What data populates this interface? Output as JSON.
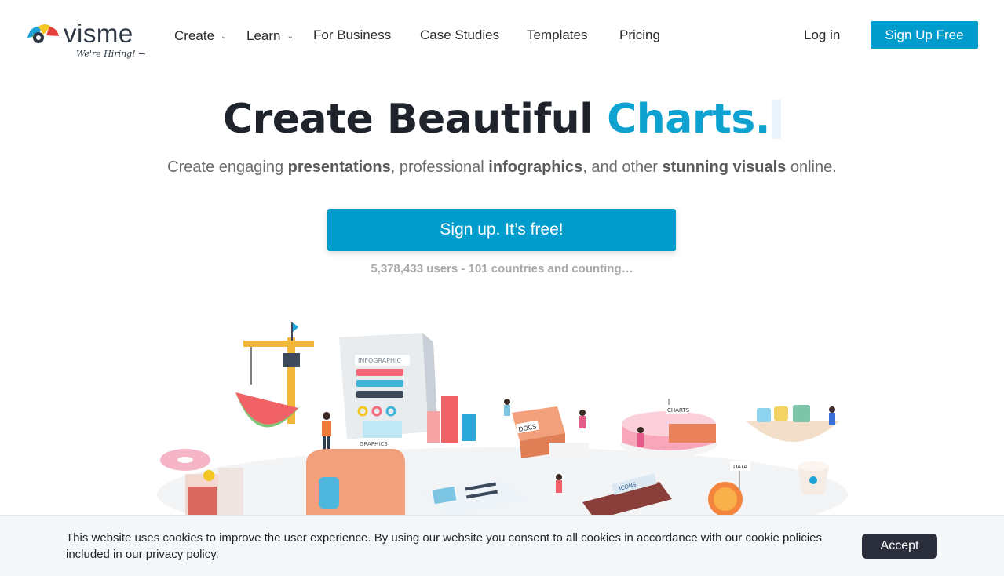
{
  "header": {
    "logo_text": "visme",
    "hiring_link": "We're Hiring! →",
    "nav": [
      {
        "label": "Create",
        "has_dropdown": true
      },
      {
        "label": "Learn",
        "has_dropdown": true
      },
      {
        "label": "For Business",
        "has_dropdown": false
      },
      {
        "label": "Case Studies",
        "has_dropdown": false
      },
      {
        "label": "Templates",
        "has_dropdown": false
      },
      {
        "label": "Pricing",
        "has_dropdown": false
      }
    ],
    "login_label": "Log in",
    "signup_label": "Sign Up Free"
  },
  "hero": {
    "title_prefix": "Create Beautiful ",
    "title_accent": "Charts.",
    "subtitle": {
      "t1": "Create engaging ",
      "b1": "presentations",
      "t2": ", professional ",
      "b2": "infographics",
      "t3": ", and other ",
      "b3": "stunning visuals",
      "t4": " online."
    },
    "cta_label": "Sign up. It’s free!",
    "counter": "5,378,433 users - 101 countries and counting…"
  },
  "illustration": {
    "labels": {
      "infographic": "INFOGRAPHIC",
      "graphics": "GRAPHICS",
      "docs": "DOCS",
      "charts": "CHARTS",
      "data": "DATA",
      "icons": "ICONS"
    }
  },
  "cookie": {
    "text": "This website uses cookies to improve the user experience. By using our website you consent to all cookies in accordance with our cookie policies included in our privacy policy.",
    "accept_label": "Accept"
  },
  "colors": {
    "brand_blue": "#009ccc",
    "accent_text": "#0ea2d1",
    "dark": "#1f242c",
    "accept_bg": "#2a2f3b"
  }
}
